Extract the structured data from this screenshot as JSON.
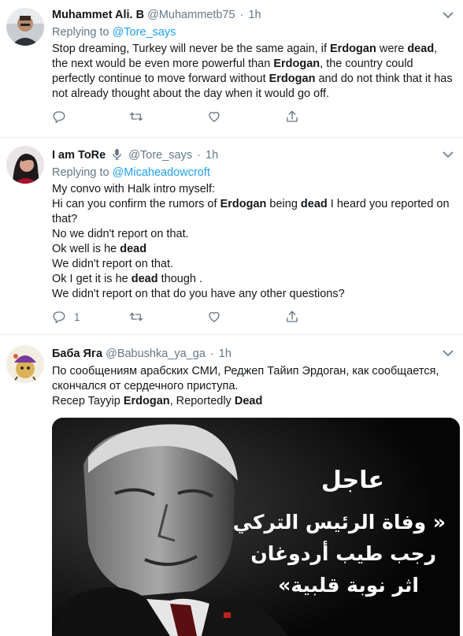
{
  "tweets": [
    {
      "name": "Muhammet Ali. B",
      "handle": "@Muhammetb75",
      "time": "1h",
      "replying_label": "Replying to",
      "replying_to": "@Tore_says",
      "body_segments": [
        {
          "text": "Stop dreaming, Turkey will never be the same again, if ",
          "bold": false
        },
        {
          "text": "Erdogan",
          "bold": true
        },
        {
          "text": " were ",
          "bold": false
        },
        {
          "text": "dead",
          "bold": true
        },
        {
          "text": ", the next would be even more powerful than ",
          "bold": false
        },
        {
          "text": "Erdogan",
          "bold": true
        },
        {
          "text": ", the country could perfectly continue to move forward without ",
          "bold": false
        },
        {
          "text": "Erdogan",
          "bold": true
        },
        {
          "text": " and do not think that it has not already thought about the day when it would go off.",
          "bold": false
        }
      ],
      "reply_count": "",
      "retweet_count": "",
      "like_count": ""
    },
    {
      "name": "I am ToRe",
      "handle": "@Tore_says",
      "time": "1h",
      "replying_label": "Replying to",
      "replying_to": "@Micaheadowcroft",
      "lines": [
        [
          {
            "text": "My convo with Halk intro myself:",
            "bold": false
          }
        ],
        [
          {
            "text": "Hi can you confirm the rumors of ",
            "bold": false
          },
          {
            "text": "Erdogan",
            "bold": true
          },
          {
            "text": " being ",
            "bold": false
          },
          {
            "text": "dead",
            "bold": true
          },
          {
            "text": " I heard you reported on that?",
            "bold": false
          }
        ],
        [
          {
            "text": "No we didn't report on that.",
            "bold": false
          }
        ],
        [
          {
            "text": "Ok well is he ",
            "bold": false
          },
          {
            "text": "dead",
            "bold": true
          }
        ],
        [
          {
            "text": "We didn't report on that.",
            "bold": false
          }
        ],
        [
          {
            "text": "Ok I get it is he ",
            "bold": false
          },
          {
            "text": "dead",
            "bold": true
          },
          {
            "text": " though .",
            "bold": false
          }
        ],
        [
          {
            "text": "We didn't report on that do you have any other questions?",
            "bold": false
          }
        ]
      ],
      "reply_count": "1",
      "retweet_count": "",
      "like_count": ""
    },
    {
      "name": "Баба Яга",
      "handle": "@Babushka_ya_ga",
      "time": "1h",
      "lines": [
        [
          {
            "text": "По сообщениям арабских СМИ, Реджеп Тайип Эрдоган, как сообщается, скончался от сердечного приступа.",
            "bold": false
          }
        ],
        [
          {
            "text": "Recep Tayyip ",
            "bold": false
          },
          {
            "text": "Erdogan",
            "bold": true
          },
          {
            "text": ", Reportedly ",
            "bold": false
          },
          {
            "text": "Dead",
            "bold": true
          }
        ]
      ],
      "media_text": {
        "heading": "عاجل",
        "line1": "« وفاة الرئيس التركي",
        "line2": "رجب طيب أردوغان",
        "line3": "اثر نوبة قلبية»"
      }
    }
  ],
  "separator": "·",
  "colors": {
    "link": "#1da1f2",
    "secondary": "#657786",
    "border": "#e6ecf0",
    "text": "#14171a"
  },
  "icons": [
    "reply-icon",
    "retweet-icon",
    "like-icon",
    "share-icon",
    "caret-down-icon",
    "microphone-icon"
  ]
}
